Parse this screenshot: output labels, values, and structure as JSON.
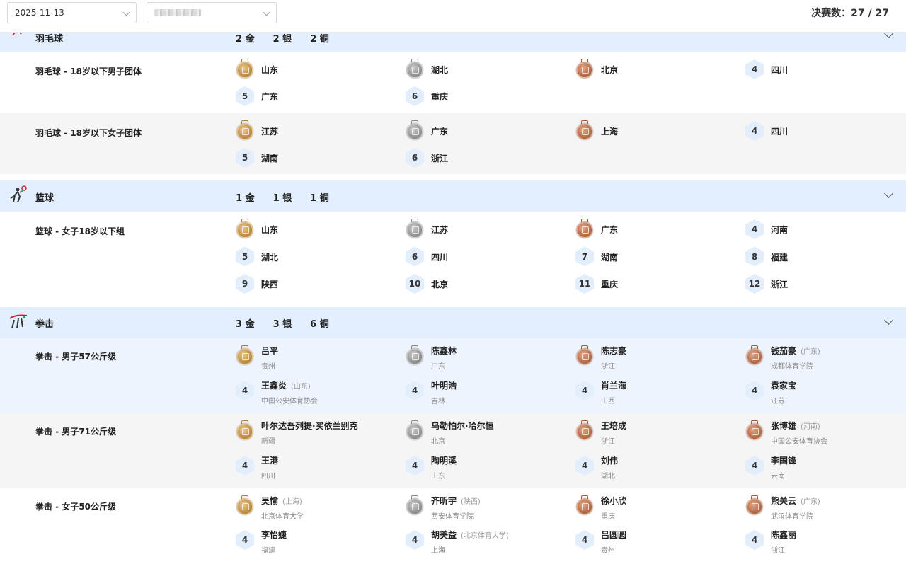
{
  "filters": {
    "date": "2025-11-13",
    "second": ""
  },
  "final_count": "决赛数：27 / 27",
  "sports": [
    {
      "name": "羽毛球",
      "tally": {
        "gold": "2 金",
        "silver": "2 银",
        "bronze": "2 铜"
      },
      "events": [
        {
          "name": "羽毛球 - 18岁以下男子团体",
          "results": [
            [
              "山东"
            ],
            [
              "湖北"
            ],
            [
              "北京"
            ],
            [
              "四川"
            ],
            [
              "广东"
            ],
            [
              "重庆"
            ]
          ]
        },
        {
          "name": "羽毛球 - 18岁以下女子团体",
          "results": [
            [
              "江苏"
            ],
            [
              "广东"
            ],
            [
              "上海"
            ],
            [
              "四川"
            ],
            [
              "湖南"
            ],
            [
              "浙江"
            ]
          ]
        }
      ]
    },
    {
      "name": "篮球",
      "tally": {
        "gold": "1 金",
        "silver": "1 银",
        "bronze": "1 铜"
      },
      "events": [
        {
          "name": "篮球 - 女子18岁以下组",
          "results": [
            [
              "山东"
            ],
            [
              "江苏"
            ],
            [
              "广东"
            ],
            [
              "河南"
            ],
            [
              "湖北"
            ],
            [
              "四川"
            ],
            [
              "湖南"
            ],
            [
              "福建"
            ],
            [
              "陕西"
            ],
            [
              "北京"
            ],
            [
              "重庆"
            ],
            [
              "浙江"
            ]
          ]
        }
      ]
    },
    {
      "name": "拳击",
      "tally": {
        "gold": "3 金",
        "silver": "3 银",
        "bronze": "6 铜"
      },
      "events": [
        {
          "name": "拳击 - 男子57公斤级",
          "results": [
            [
              "吕平",
              "",
              "贵州"
            ],
            [
              "陈鑫林",
              "",
              "广东"
            ],
            [
              "陈志豪",
              "",
              "浙江"
            ],
            [
              "钱茄豪",
              "(广东)",
              "成都体育学院"
            ],
            [
              "王鑫炎",
              "(山东)",
              "中国公安体育协会"
            ],
            [
              "叶明浩",
              "",
              "吉林"
            ],
            [
              "肖兰海",
              "",
              "山西"
            ],
            [
              "袁家宝",
              "",
              "江苏"
            ]
          ]
        },
        {
          "name": "拳击 - 男子71公斤级",
          "results": [
            [
              "叶尔达吾列提·买依兰别克",
              "",
              "新疆"
            ],
            [
              "乌勒怕尔·哈尔恒",
              "",
              "北京"
            ],
            [
              "王培成",
              "",
              "浙江"
            ],
            [
              "张博雄",
              "(河南)",
              "中国公安体育协会"
            ],
            [
              "王港",
              "",
              "四川"
            ],
            [
              "陶明溪",
              "",
              "山东"
            ],
            [
              "刘伟",
              "",
              "湖北"
            ],
            [
              "李国锋",
              "",
              "云南"
            ]
          ]
        },
        {
          "name": "拳击 - 女子50公斤级",
          "results": [
            [
              "吴愉",
              "(上海)",
              "北京体育大学"
            ],
            [
              "齐昕宇",
              "(陕西)",
              "西安体育学院"
            ],
            [
              "徐小欣",
              "",
              "重庆"
            ],
            [
              "熊关云",
              "(广东)",
              "武汉体育学院"
            ],
            [
              "李怡婕",
              "",
              "福建"
            ],
            [
              "胡美益",
              "(北京体育大学)",
              "上海"
            ],
            [
              "吕圆圆",
              "",
              "贵州"
            ],
            [
              "陈鑫丽",
              "",
              "浙江"
            ]
          ]
        }
      ]
    }
  ],
  "ranks": [
    "4",
    "5",
    "6",
    "7",
    "8",
    "9",
    "10",
    "11",
    "12"
  ]
}
